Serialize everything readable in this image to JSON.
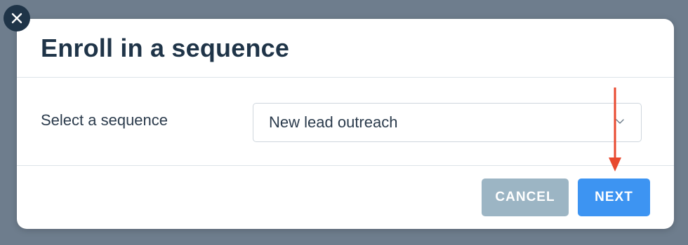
{
  "dialog": {
    "title": "Enroll in a sequence",
    "close_icon": "close-icon"
  },
  "form": {
    "sequence_label": "Select a sequence",
    "sequence_value": "New lead outreach",
    "dropdown_icon": "chevron-down-icon"
  },
  "footer": {
    "cancel_label": "CANCEL",
    "next_label": "NEXT"
  },
  "annotation": {
    "arrow_icon": "arrow-down-icon",
    "arrow_color": "#e8492f"
  },
  "colors": {
    "overlay": "#6e7d8d",
    "title": "#1f3448",
    "cancel_button": "#9cb5c4",
    "next_button": "#3d94f2"
  }
}
